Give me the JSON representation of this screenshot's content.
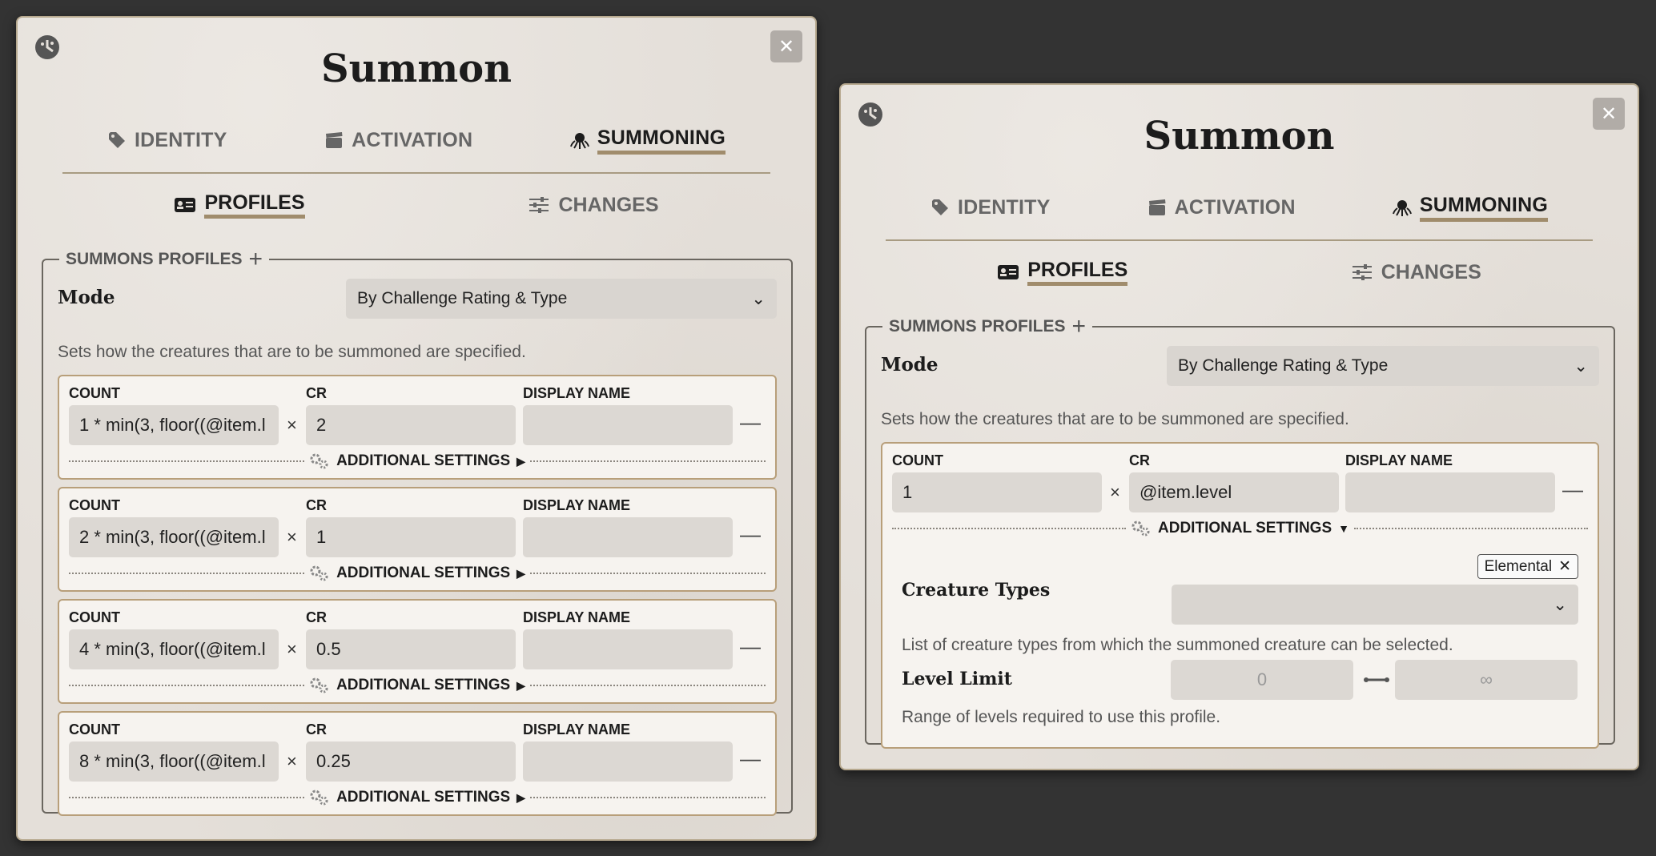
{
  "windows": [
    {
      "title": "Summon",
      "close_label": "✕",
      "tabs": [
        "IDENTITY",
        "ACTIVATION",
        "SUMMONING"
      ],
      "subtabs": [
        "PROFILES",
        "CHANGES"
      ],
      "legend": "SUMMONS PROFILES",
      "mode_label": "Mode",
      "mode_value": "By Challenge Rating & Type",
      "mode_hint": "Sets how the creatures that are to be summoned are specified.",
      "columns": {
        "count": "COUNT",
        "cr": "CR",
        "display_name": "DISPLAY NAME"
      },
      "additional_settings": "ADDITIONAL SETTINGS",
      "profiles": [
        {
          "count": "1 * min(3, floor((@item.l",
          "cr": "2",
          "display_name": ""
        },
        {
          "count": "2 * min(3, floor((@item.l",
          "cr": "1",
          "display_name": ""
        },
        {
          "count": "4 * min(3, floor((@item.l",
          "cr": "0.5",
          "display_name": ""
        },
        {
          "count": "8 * min(3, floor((@item.l",
          "cr": "0.25",
          "display_name": ""
        }
      ]
    },
    {
      "title": "Summon",
      "close_label": "✕",
      "tabs": [
        "IDENTITY",
        "ACTIVATION",
        "SUMMONING"
      ],
      "subtabs": [
        "PROFILES",
        "CHANGES"
      ],
      "legend": "SUMMONS PROFILES",
      "mode_label": "Mode",
      "mode_value": "By Challenge Rating & Type",
      "mode_hint": "Sets how the creatures that are to be summoned are specified.",
      "columns": {
        "count": "COUNT",
        "cr": "CR",
        "display_name": "DISPLAY NAME"
      },
      "additional_settings": "ADDITIONAL SETTINGS",
      "profiles": [
        {
          "count": "1",
          "cr": "@item.level",
          "display_name": ""
        }
      ],
      "expanded": {
        "creature_types_label": "Creature Types",
        "creature_tag": "Elemental",
        "creature_hint": "List of creature types from which the summoned creature can be selected.",
        "level_limit_label": "Level Limit",
        "level_min_placeholder": "0",
        "level_max_placeholder": "∞",
        "level_hint": "Range of levels required to use this profile."
      }
    }
  ],
  "active_tab": "SUMMONING",
  "active_subtab": "PROFILES",
  "colors": {
    "background": "#333333",
    "accent": "#a08c6c",
    "panel": "#e4dfd9"
  }
}
